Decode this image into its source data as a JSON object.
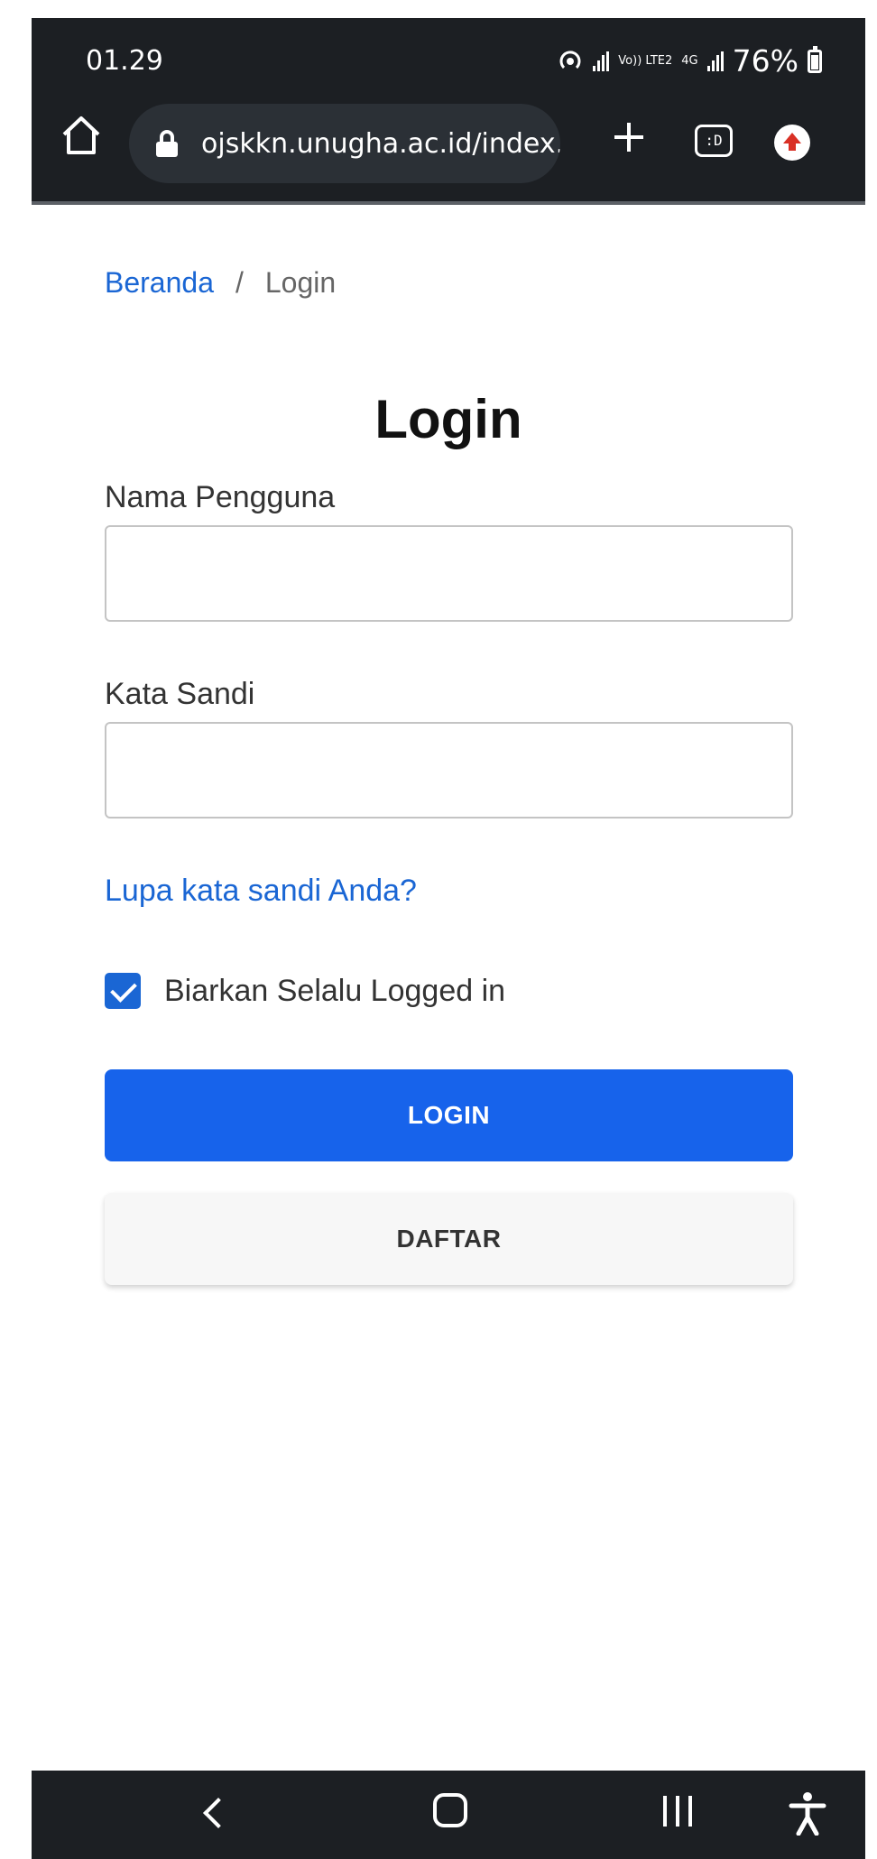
{
  "status_bar": {
    "time": "01.29",
    "network_volte": "Vo)) LTE2",
    "network_type": "4G",
    "battery": "76%"
  },
  "browser": {
    "url": "ojskkn.unugha.ac.id/index.ph",
    "tab_icon_text": ":D",
    "icons": [
      "home-icon",
      "lock-icon",
      "plus-icon",
      "tab-switcher-icon",
      "update-icon"
    ]
  },
  "breadcrumb": {
    "home": "Beranda",
    "separator": "/",
    "current": "Login"
  },
  "form": {
    "title": "Login",
    "username_label": "Nama Pengguna",
    "username_value": "",
    "password_label": "Kata Sandi",
    "password_value": "",
    "forgot_link": "Lupa kata sandi Anda?",
    "remember_label": "Biarkan Selalu Logged in",
    "remember_checked": true,
    "login_button": "LOGIN",
    "register_button": "DAFTAR"
  },
  "colors": {
    "link": "#1a66d4",
    "primary_button": "#1763eb",
    "chrome": "#1c1f23"
  },
  "navbar": {
    "icons": [
      "back-icon",
      "home-icon",
      "recent-apps-icon",
      "accessibility-icon"
    ]
  }
}
